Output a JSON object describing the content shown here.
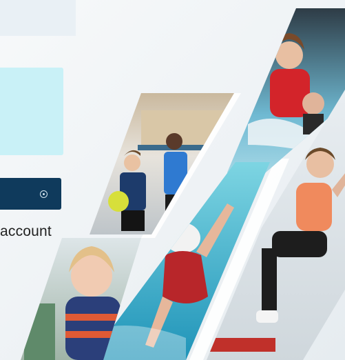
{
  "form": {
    "account_link_text": "account"
  },
  "colors": {
    "info_box": "#c9f1f7",
    "button": "#0f3a5c",
    "background": "#f3f6f8"
  },
  "icons": {
    "submit": "circle-dot-icon"
  },
  "collage": {
    "photos": [
      "kids-sports-photo",
      "swimmer-photo",
      "fitness-class-photo",
      "toddler-photo",
      "aqua-class-photo"
    ]
  }
}
